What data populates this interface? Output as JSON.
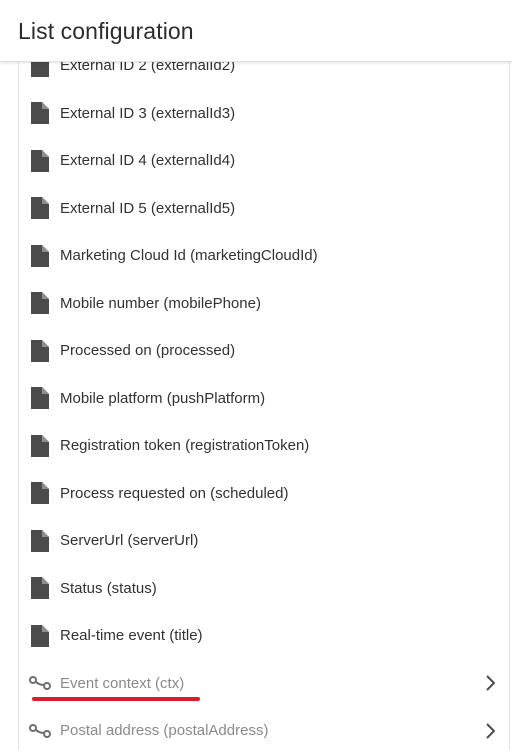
{
  "header": {
    "title": "List configuration"
  },
  "fields": [
    {
      "label": "External ID 2 (externalId2)",
      "type": "file"
    },
    {
      "label": "External ID 3 (externalId3)",
      "type": "file"
    },
    {
      "label": "External ID 4 (externalId4)",
      "type": "file"
    },
    {
      "label": "External ID 5 (externalId5)",
      "type": "file"
    },
    {
      "label": "Marketing Cloud Id (marketingCloudId)",
      "type": "file"
    },
    {
      "label": "Mobile number (mobilePhone)",
      "type": "file"
    },
    {
      "label": "Processed on (processed)",
      "type": "file"
    },
    {
      "label": "Mobile platform (pushPlatform)",
      "type": "file"
    },
    {
      "label": "Registration token (registrationToken)",
      "type": "file"
    },
    {
      "label": "Process requested on (scheduled)",
      "type": "file"
    },
    {
      "label": "ServerUrl (serverUrl)",
      "type": "file"
    },
    {
      "label": "Status (status)",
      "type": "file"
    },
    {
      "label": "Real-time event (title)",
      "type": "file"
    },
    {
      "label": "Event context (ctx)",
      "type": "link",
      "expandable": true,
      "highlighted": true
    },
    {
      "label": "Postal address (postalAddress)",
      "type": "link",
      "expandable": true
    }
  ],
  "icons": {
    "file": "file-icon",
    "link": "link-icon",
    "expand": "chevron-right-icon"
  },
  "colors": {
    "text": "#323232",
    "link_text": "#8a8a8a",
    "icon": "#4b4b4b",
    "highlight": "#d3202a"
  }
}
